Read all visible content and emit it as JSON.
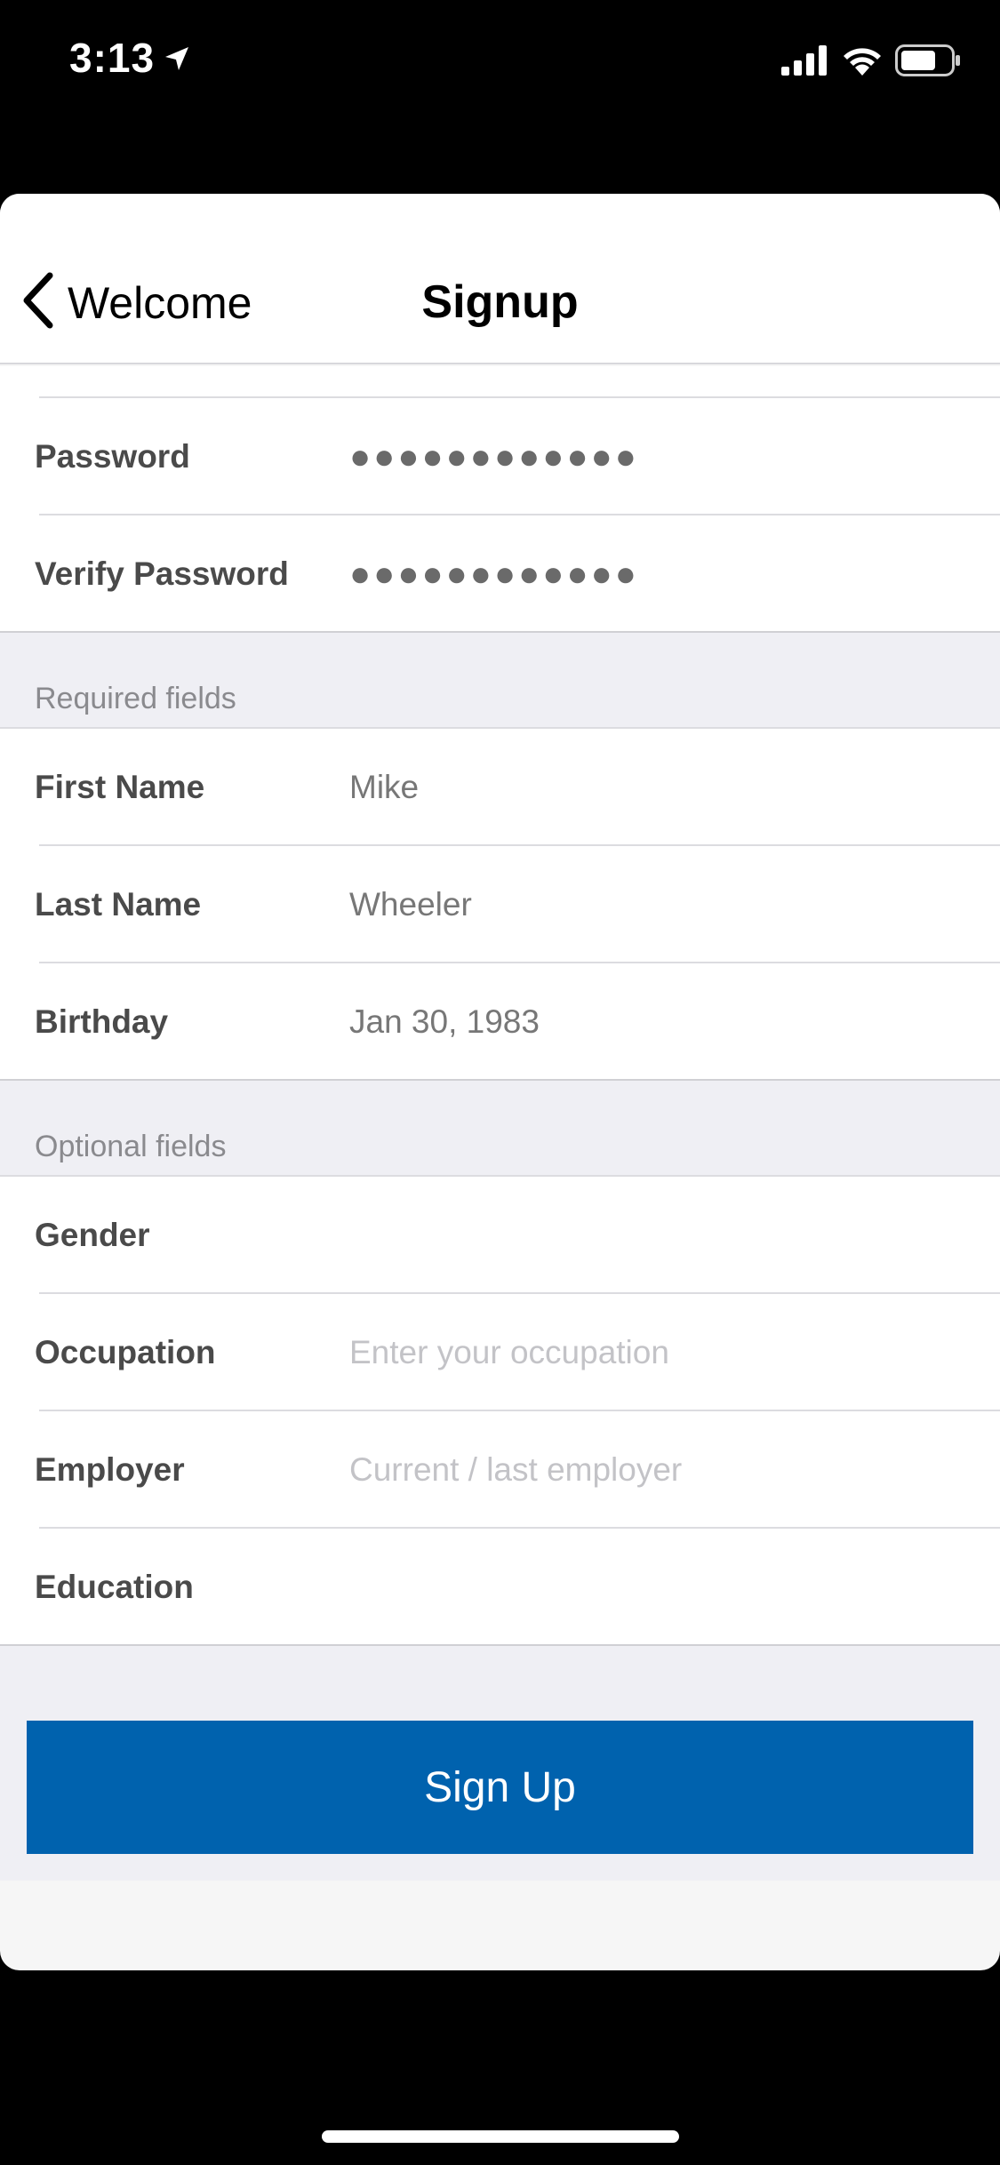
{
  "status_bar": {
    "time": "3:13"
  },
  "navbar": {
    "back_label": "Welcome",
    "title": "Signup"
  },
  "account_fields": [
    {
      "label": "Password",
      "value": "●●●●●●●●●●●●"
    },
    {
      "label": "Verify Password",
      "value": "●●●●●●●●●●●●"
    }
  ],
  "required": {
    "header": "Required fields",
    "first_name": {
      "label": "First Name",
      "value": "Mike"
    },
    "last_name": {
      "label": "Last Name",
      "value": "Wheeler"
    },
    "birthday": {
      "label": "Birthday",
      "value": "Jan 30, 1983"
    }
  },
  "optional": {
    "header": "Optional fields",
    "gender": {
      "label": "Gender",
      "value": ""
    },
    "occupation": {
      "label": "Occupation",
      "placeholder": "Enter your occupation"
    },
    "employer": {
      "label": "Employer",
      "placeholder": "Current / last employer"
    },
    "education": {
      "label": "Education",
      "value": ""
    }
  },
  "signup_button": {
    "label": "Sign Up"
  },
  "colors": {
    "accent": "#0062ae",
    "section_background": "#efeff4"
  },
  "icons": [
    "location-arrow-icon",
    "cellular-signal-icon",
    "wifi-icon",
    "battery-icon",
    "chevron-left-icon"
  ]
}
